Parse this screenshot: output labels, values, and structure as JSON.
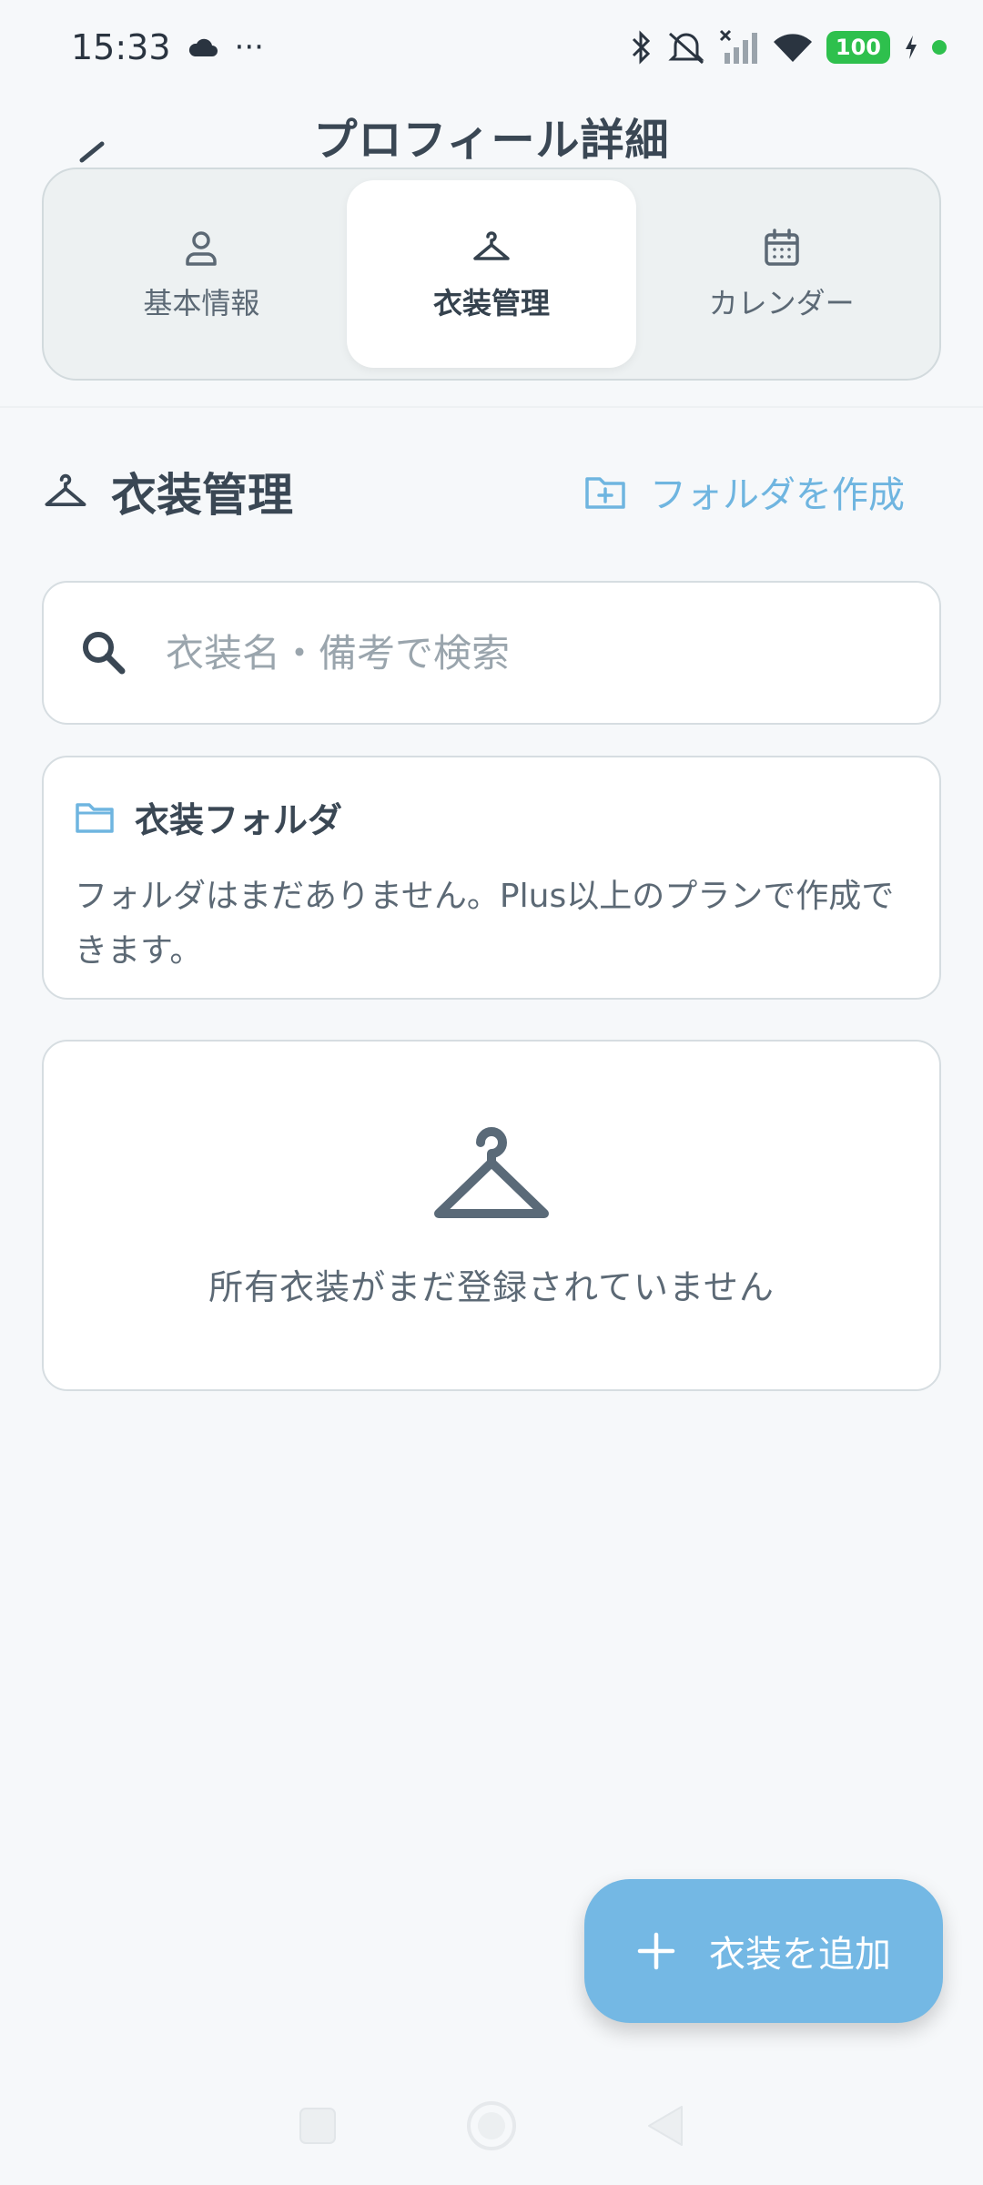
{
  "status_bar": {
    "time": "15:33",
    "dots": "···",
    "battery": "100"
  },
  "header": {
    "title": "プロフィール詳細"
  },
  "tabs": [
    {
      "label": "基本情報",
      "icon": "person-icon",
      "active": false
    },
    {
      "label": "衣装管理",
      "icon": "hanger-icon",
      "active": true
    },
    {
      "label": "カレンダー",
      "icon": "calendar-icon",
      "active": false
    }
  ],
  "section": {
    "title": "衣装管理",
    "create_folder_label": "フォルダを作成"
  },
  "search": {
    "placeholder": "衣装名・備考で検索",
    "value": ""
  },
  "folder_card": {
    "title": "衣装フォルダ",
    "description": "フォルダはまだありません。Plus以上のプランで作成できます。"
  },
  "empty_state": {
    "message": "所有衣装がまだ登録されていません"
  },
  "fab": {
    "label": "衣装を追加"
  },
  "colors": {
    "accent": "#74b8e4",
    "text": "#3a4754",
    "background": "#f6f8fa",
    "battery": "#2ec04d"
  }
}
